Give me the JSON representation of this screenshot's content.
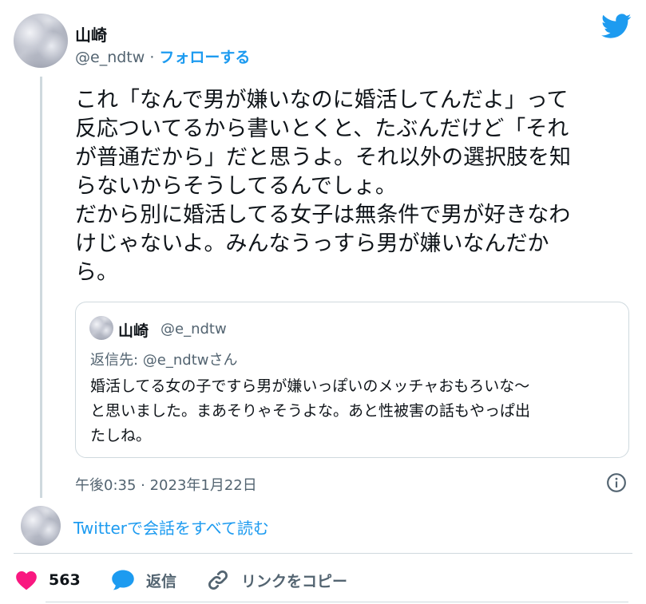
{
  "author": {
    "name": "山崎",
    "handle": "@e_ndtw",
    "separator": " · ",
    "follow_label": "フォローする"
  },
  "tweet": {
    "text": "これ「なんで男が嫌いなのに婚活してんだよ」って\n反応ついてるから書いとくと、たぶんだけど「それ\nが普通だから」だと思うよ。それ以外の選択肢を知\nらないからそうしてるんでしょ。\nだから別に婚活してる女子は無条件で男が好きなわ\nけじゃないよ。みんなうっすら男が嫌いなんだか\nら。"
  },
  "quoted": {
    "name": "山崎",
    "handle": "@e_ndtw",
    "reply_to": "返信先: @e_ndtwさん",
    "text": "婚活してる女の子ですら男が嫌いっぽいのメッチャおもろいな〜\nと思いました。まあそりゃそうよな。あと性被害の話もやっぱ出\nたしね。"
  },
  "timestamp": "午後0:35 · 2023年1月22日",
  "read_all": "Twitterで会話をすべて読む",
  "actions": {
    "like_count": "563",
    "reply_label": "返信",
    "copy_link_label": "リンクをコピー"
  },
  "icons": {
    "logo": "twitter-bird-icon",
    "info": "info-icon",
    "like": "heart-icon",
    "reply": "speech-bubble-icon",
    "copy": "link-icon"
  },
  "colors": {
    "brand_blue": "#1d9bf0",
    "like_pink": "#f91880",
    "secondary_text": "#536471",
    "border": "#cfd9de"
  }
}
